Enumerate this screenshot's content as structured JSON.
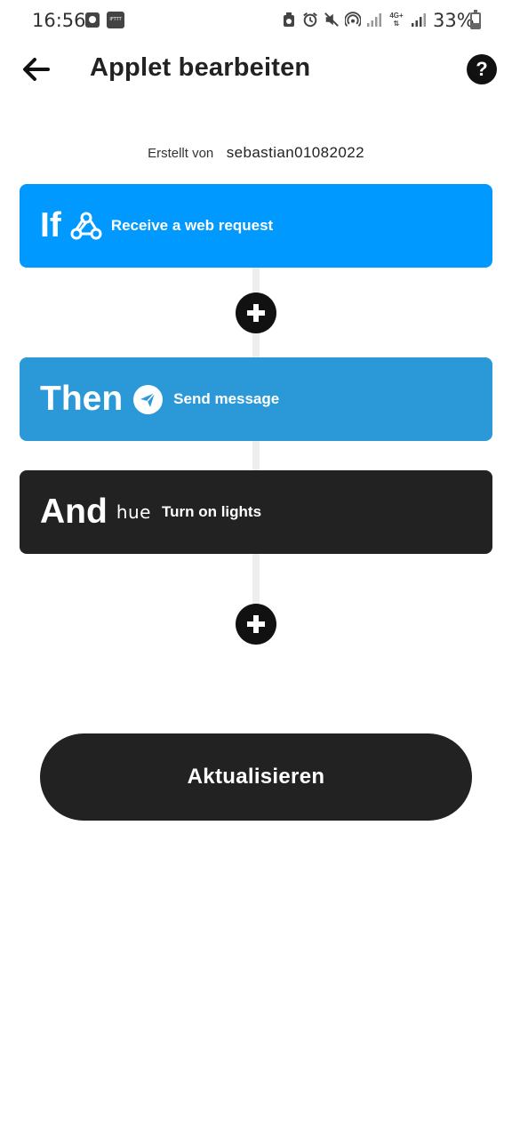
{
  "status_bar": {
    "time": "16:56",
    "battery_percent_text": "33%",
    "battery_level": 0.33,
    "notification_icon_1": "clock-app-icon",
    "notification_icon_2": "ifttt-app-icon",
    "notification_icon_2_text": "IFTTT",
    "network_label": "4G+",
    "icons": [
      "recycle-icon",
      "alarm-icon",
      "mute-icon",
      "hotspot-icon",
      "signal-icon",
      "signal-4g-icon",
      "battery-icon"
    ]
  },
  "header": {
    "back_icon": "arrow-left-icon",
    "title": "Applet bearbeiten",
    "help_label": "?"
  },
  "creator": {
    "label": "Erstellt von",
    "name": "sebastian01082022"
  },
  "steps": {
    "if": {
      "keyword": "If",
      "icon": "webhooks-icon",
      "action": "Receive a web request",
      "color": "#0099ff"
    },
    "then": {
      "keyword": "Then",
      "icon": "telegram-icon",
      "action": "Send message",
      "color": "#2b98d8"
    },
    "and": {
      "keyword": "And",
      "service_logo": "hue",
      "action": "Turn on lights",
      "color": "#222222"
    }
  },
  "add_buttons": [
    "plus-icon",
    "plus-icon"
  ],
  "primary_button": {
    "label": "Aktualisieren"
  },
  "colors": {
    "dark": "#222222",
    "connector": "#eeeeee",
    "background": "#ffffff"
  }
}
